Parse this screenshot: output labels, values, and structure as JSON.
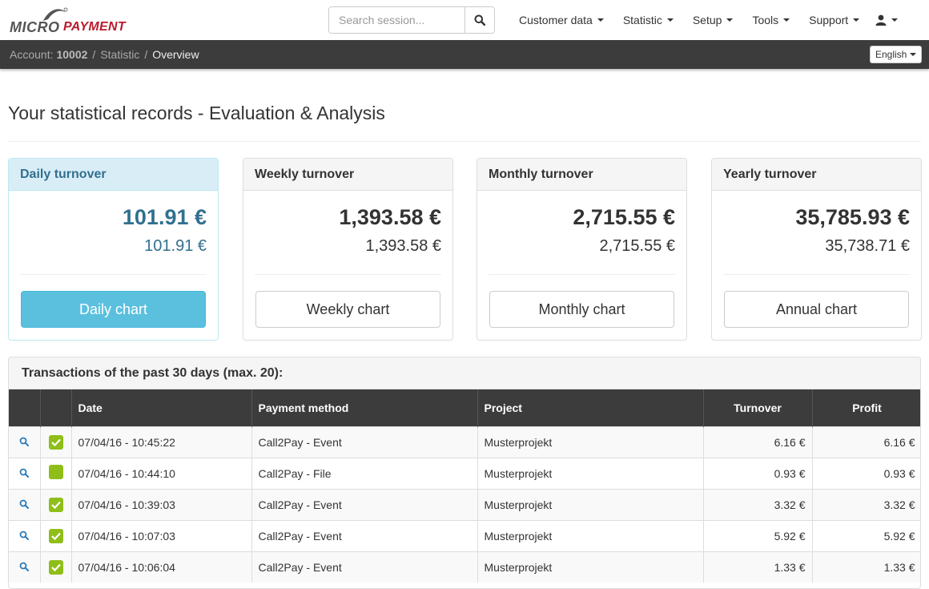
{
  "brand": {
    "part1": "MICRO",
    "part2": "PAYMENT",
    "accent": "#b81c2c"
  },
  "search": {
    "placeholder": "Search session...",
    "icon": "search-icon"
  },
  "menu": [
    {
      "label": "Customer data"
    },
    {
      "label": "Statistic"
    },
    {
      "label": "Setup"
    },
    {
      "label": "Tools"
    },
    {
      "label": "Support"
    }
  ],
  "user_icon": "user-icon",
  "breadcrumb": {
    "account_label": "Account:",
    "account_id": "10002",
    "section": "Statistic",
    "page": "Overview"
  },
  "language": "English",
  "page_title": "Your statistical records - Evaluation & Analysis",
  "cards": [
    {
      "title": "Daily turnover",
      "primary": "101.91 €",
      "secondary": "101.91 €",
      "button": "Daily chart"
    },
    {
      "title": "Weekly turnover",
      "primary": "1,393.58 €",
      "secondary": "1,393.58 €",
      "button": "Weekly chart"
    },
    {
      "title": "Monthly turnover",
      "primary": "2,715.55 €",
      "secondary": "2,715.55 €",
      "button": "Monthly chart"
    },
    {
      "title": "Yearly turnover",
      "primary": "35,785.93 €",
      "secondary": "35,738.71 €",
      "button": "Annual chart"
    }
  ],
  "transactions": {
    "title": "Transactions of the past 30 days (max. 20):",
    "columns": [
      "Date",
      "Payment method",
      "Project",
      "Turnover",
      "Profit"
    ],
    "rows": [
      {
        "checked": true,
        "date": "07/04/16 - 10:45:22",
        "method": "Call2Pay - Event",
        "project": "Musterprojekt",
        "turnover": "6.16 €",
        "profit": "6.16 €"
      },
      {
        "checked": false,
        "date": "07/04/16 - 10:44:10",
        "method": "Call2Pay - File",
        "project": "Musterprojekt",
        "turnover": "0.93 €",
        "profit": "0.93 €"
      },
      {
        "checked": true,
        "date": "07/04/16 - 10:39:03",
        "method": "Call2Pay - Event",
        "project": "Musterprojekt",
        "turnover": "3.32 €",
        "profit": "3.32 €"
      },
      {
        "checked": true,
        "date": "07/04/16 - 10:07:03",
        "method": "Call2Pay - Event",
        "project": "Musterprojekt",
        "turnover": "5.92 €",
        "profit": "5.92 €"
      },
      {
        "checked": true,
        "date": "07/04/16 - 10:06:04",
        "method": "Call2Pay - Event",
        "project": "Musterprojekt",
        "turnover": "1.33 €",
        "profit": "1.33 €"
      }
    ]
  }
}
